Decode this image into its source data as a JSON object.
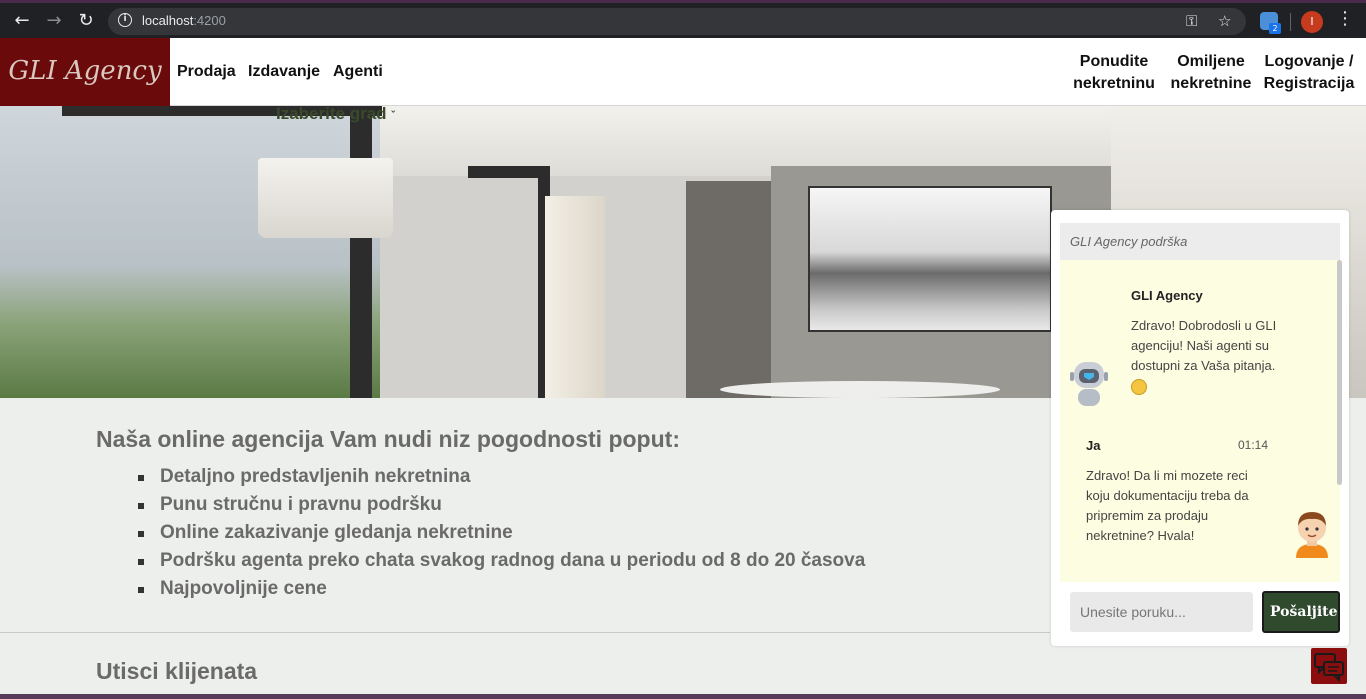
{
  "browser": {
    "url_host": "localhost",
    "url_port": ":4200",
    "extension_badge": "2",
    "profile_initial": "I"
  },
  "header": {
    "logo": "GLI Agency",
    "nav_left": [
      "Prodaja",
      "Izdavanje",
      "Agenti"
    ],
    "nav_right": [
      {
        "line1": "Ponudite",
        "line2": "nekretninu"
      },
      {
        "line1": "Omiljene",
        "line2": "nekretnine"
      },
      {
        "line1": "Logovanje /",
        "line2": "Registracija"
      }
    ]
  },
  "city_select": "Izaberite grad",
  "benefits": {
    "title": "Naša online agencija Vam nudi niz pogodnosti poput:",
    "items": [
      "Detaljno predstavljenih nekretnina",
      "Punu stručnu i pravnu podršku",
      "Online zakazivanje gledanja nekretnine",
      "Podršku agenta preko chata svakog radnog dana u periodu od 8 do 20 časova",
      "Najpovoljnije cene"
    ]
  },
  "testimonials_title": "Utisci klijenata",
  "chat": {
    "title": "GLI Agency podrška",
    "messages": [
      {
        "sender": "GLI Agency",
        "text": "Zdravo! Dobrodosli u GLI agenciju! Naši agenti su dostupni za Vaša pitanja."
      },
      {
        "sender": "Ja",
        "time": "01:14",
        "text": "Zdravo! Da li mi mozete reci koju dokumentaciju treba da pripremim za prodaju nekretnine? Hvala!"
      }
    ],
    "input_placeholder": "Unesite poruku...",
    "send_label": "Pošaljite"
  },
  "colors": {
    "logo_bg": "#6b0a0a",
    "send_button": "#304a2e",
    "chat_body": "#fdfde2",
    "chat_toggle": "#8a0e0e"
  }
}
